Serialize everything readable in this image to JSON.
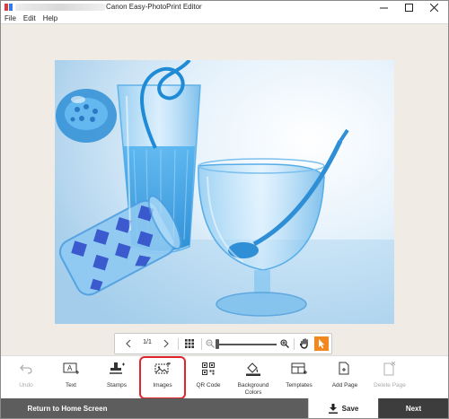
{
  "window": {
    "title": "Canon Easy-PhotoPrint Editor",
    "controls": {
      "minimize": "minimize-icon",
      "maximize": "maximize-icon",
      "close": "close-icon"
    }
  },
  "menu": {
    "items": [
      "File",
      "Edit",
      "Help"
    ]
  },
  "canvas": {
    "image": "glassware-photo"
  },
  "zoombar": {
    "page_indicator": "1/1",
    "zoom_level": 0,
    "icons": [
      "chevron-left-icon",
      "chevron-right-icon",
      "grid-icon",
      "zoom-out-icon",
      "zoom-in-icon",
      "hand-icon",
      "pointer-icon"
    ]
  },
  "tools": [
    {
      "label": "Undo",
      "icon": "undo-icon",
      "enabled": false
    },
    {
      "label": "Text",
      "icon": "text-icon",
      "enabled": true
    },
    {
      "label": "Stamps",
      "icon": "stamp-icon",
      "enabled": true
    },
    {
      "label": "Images",
      "icon": "images-icon",
      "enabled": true,
      "highlighted": true
    },
    {
      "label": "QR Code",
      "icon": "qr-code-icon",
      "enabled": true
    },
    {
      "label": "Background\nColors",
      "icon": "background-colors-icon",
      "enabled": true
    },
    {
      "label": "Templates",
      "icon": "templates-icon",
      "enabled": true
    },
    {
      "label": "Add Page",
      "icon": "add-page-icon",
      "enabled": true
    },
    {
      "label": "Delete Page",
      "icon": "delete-page-icon",
      "enabled": false
    }
  ],
  "bottom": {
    "home_label": "Return to Home Screen",
    "save_label": "Save",
    "next_label": "Next"
  },
  "colors": {
    "accent": "#f2871f",
    "highlight": "#e0252c",
    "bottom_bar": "#5d5d5d"
  }
}
